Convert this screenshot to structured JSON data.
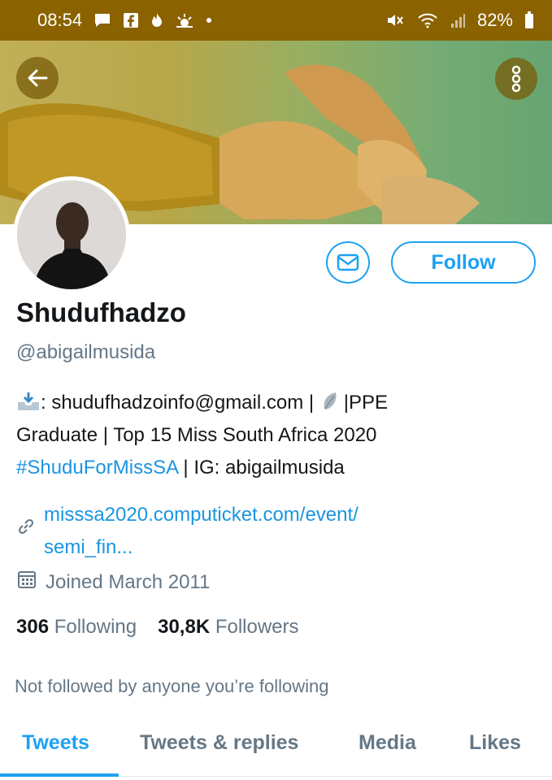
{
  "status_bar": {
    "time": "08:54",
    "battery": "82%"
  },
  "profile": {
    "name": "Shudufhadzo",
    "handle": "@abigailmusida",
    "follow_label": "Follow",
    "bio": {
      "line1": ": shudufhadzoinfo@gmail.com | ",
      "line1b": "|PPE",
      "line2": "Graduate | Top 15 Miss South Africa 2020",
      "hashtag": "#ShuduForMissSA",
      "line3_rest": " | IG: abigailmusida"
    },
    "link_line1": "misssa2020.computicket.com/event/",
    "link_line2": "semi_fin...",
    "joined": "Joined March 2011",
    "following_count": "306",
    "following_label": "Following",
    "followers_count": "30,8K",
    "followers_label": "Followers",
    "not_followed_text": "Not followed by anyone you’re following"
  },
  "tabs": [
    "Tweets",
    "Tweets & replies",
    "Media",
    "Likes"
  ],
  "colors": {
    "accent": "#1da1f2",
    "link": "#1b95e0",
    "status_bar": "#8a6200"
  }
}
